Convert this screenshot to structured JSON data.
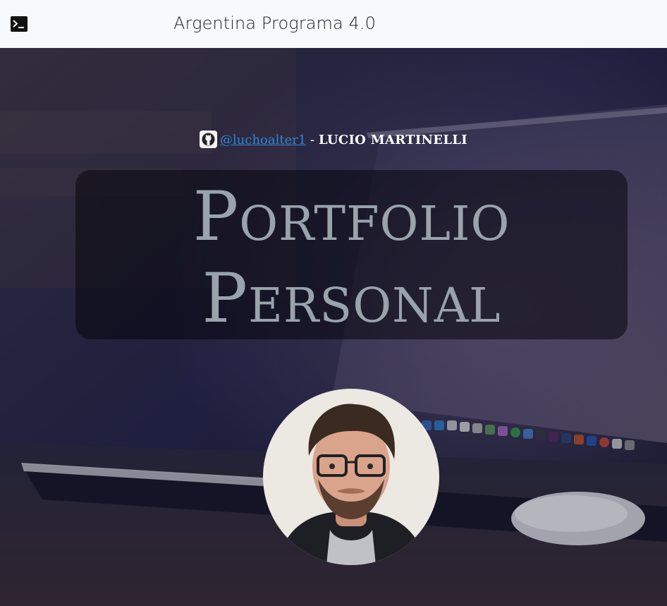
{
  "navbar": {
    "icon": "terminal-icon",
    "brand": "Argentina Programa 4.0"
  },
  "hero": {
    "github_icon": "github-icon",
    "github_handle": "@luchoalter1",
    "separator": " - ",
    "author_name": "LUCIO MARTINELLI",
    "title_line1": "Portfolio",
    "title_line2": "Personal",
    "avatar_icon": "profile-photo"
  },
  "colors": {
    "navbar_bg": "#f8f9fa",
    "link": "#2f86d6",
    "title_text": "#9aa3ad",
    "hero_bg": "#1f1f3a"
  }
}
